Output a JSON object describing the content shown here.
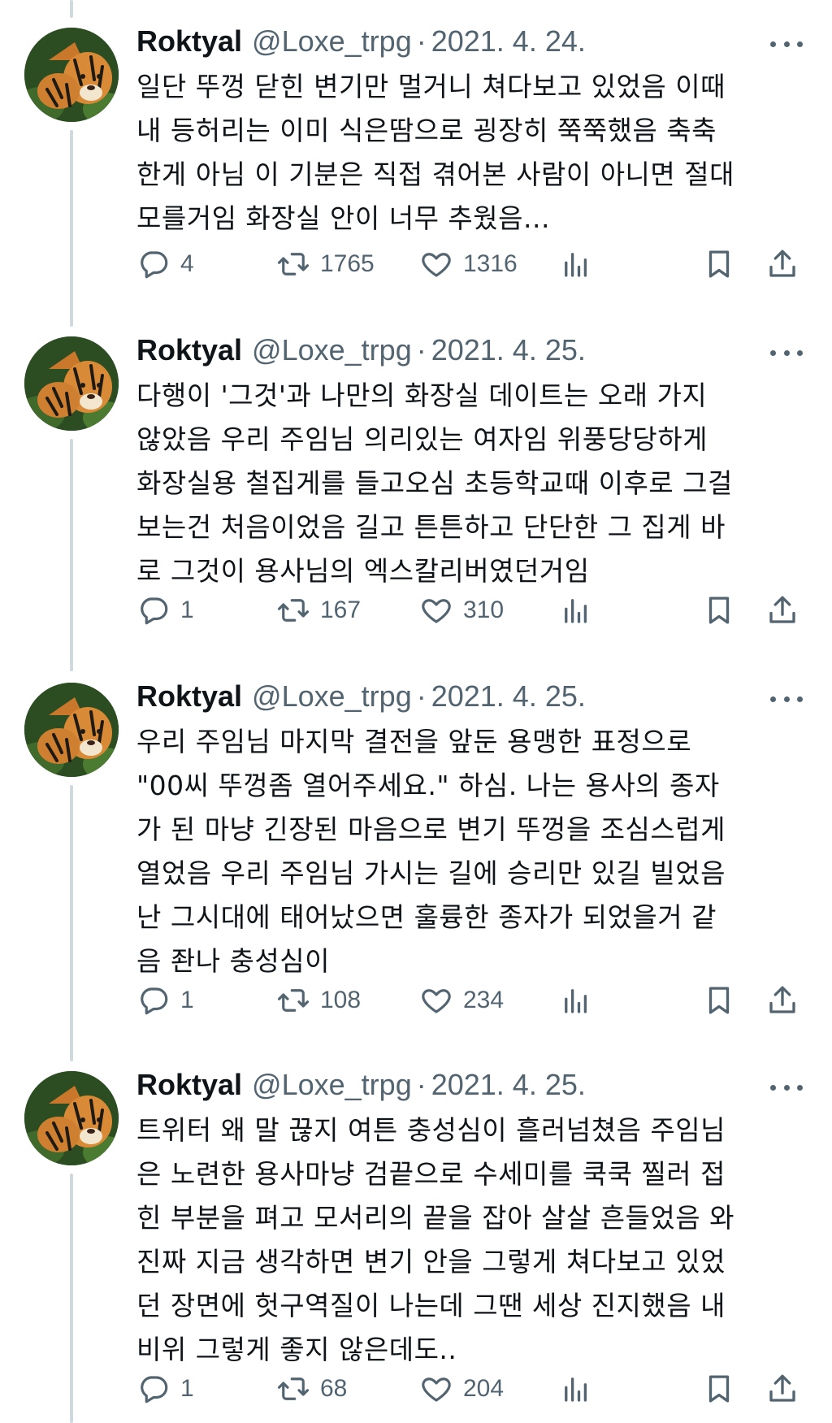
{
  "tweets": [
    {
      "name": "Roktyal",
      "handle": "@Loxe_trpg",
      "separator": "·",
      "date": "2021. 4. 24.",
      "lines": [
        "일단 뚜껑 닫힌 변기만 멀거니 쳐다보고 있었음 이때",
        "내 등허리는 이미 식은땀으로 굉장히 쭉쭉했음 축축",
        "한게 아님 이 기분은 직접 겪어본 사람이 아니면 절대",
        "모를거임 화장실 안이 너무 추웠음..."
      ],
      "replies": "4",
      "retweets": "1765",
      "likes": "1316"
    },
    {
      "name": "Roktyal",
      "handle": "@Loxe_trpg",
      "separator": "·",
      "date": "2021. 4. 25.",
      "lines": [
        "다행이 '그것'과 나만의 화장실 데이트는 오래 가지",
        "않았음 우리 주임님 의리있는 여자임 위풍당당하게",
        "화장실용 철집게를 들고오심 초등학교때 이후로 그걸",
        "보는건 처음이었음 길고 튼튼하고 단단한 그 집게 바",
        "로 그것이 용사님의 엑스칼리버였던거임"
      ],
      "replies": "1",
      "retweets": "167",
      "likes": "310"
    },
    {
      "name": "Roktyal",
      "handle": "@Loxe_trpg",
      "separator": "·",
      "date": "2021. 4. 25.",
      "lines": [
        "우리 주임님 마지막 결전을 앞둔 용맹한 표정으로",
        "\"00씨 뚜껑좀 열어주세요.\" 하심. 나는 용사의 종자",
        "가 된 마냥 긴장된 마음으로 변기 뚜껑을 조심스럽게",
        "열었음 우리 주임님 가시는 길에 승리만 있길 빌었음",
        "난 그시대에 태어났으면 훌륭한 종자가 되었을거 같",
        "음 좐나 충성심이"
      ],
      "replies": "1",
      "retweets": "108",
      "likes": "234"
    },
    {
      "name": "Roktyal",
      "handle": "@Loxe_trpg",
      "separator": "·",
      "date": "2021. 4. 25.",
      "lines": [
        "트위터 왜 말 끊지 여튼 충성심이 흘러넘쳤음 주임님",
        "은 노련한 용사마냥 검끝으로 수세미를 쿡쿡 찔러 접",
        "힌 부분을 펴고 모서리의 끝을 잡아 살살 흔들었음 와",
        "진짜 지금 생각하면 변기 안을 그렇게 쳐다보고 있었",
        "던 장면에 헛구역질이 나는데 그땐 세상 진지했음 내",
        "비위 그렇게 좋지 않은데도.."
      ],
      "replies": "1",
      "retweets": "68",
      "likes": "204"
    }
  ],
  "icons": {
    "reply": "reply-icon",
    "retweet": "retweet-icon",
    "like": "heart-icon",
    "views": "views-icon",
    "bookmark": "bookmark-icon",
    "share": "share-icon",
    "more": "more-icon",
    "avatar": "tiger-avatar"
  },
  "colors": {
    "text": "#0f1419",
    "secondary": "#536471",
    "thread_line": "#cfd9de"
  }
}
